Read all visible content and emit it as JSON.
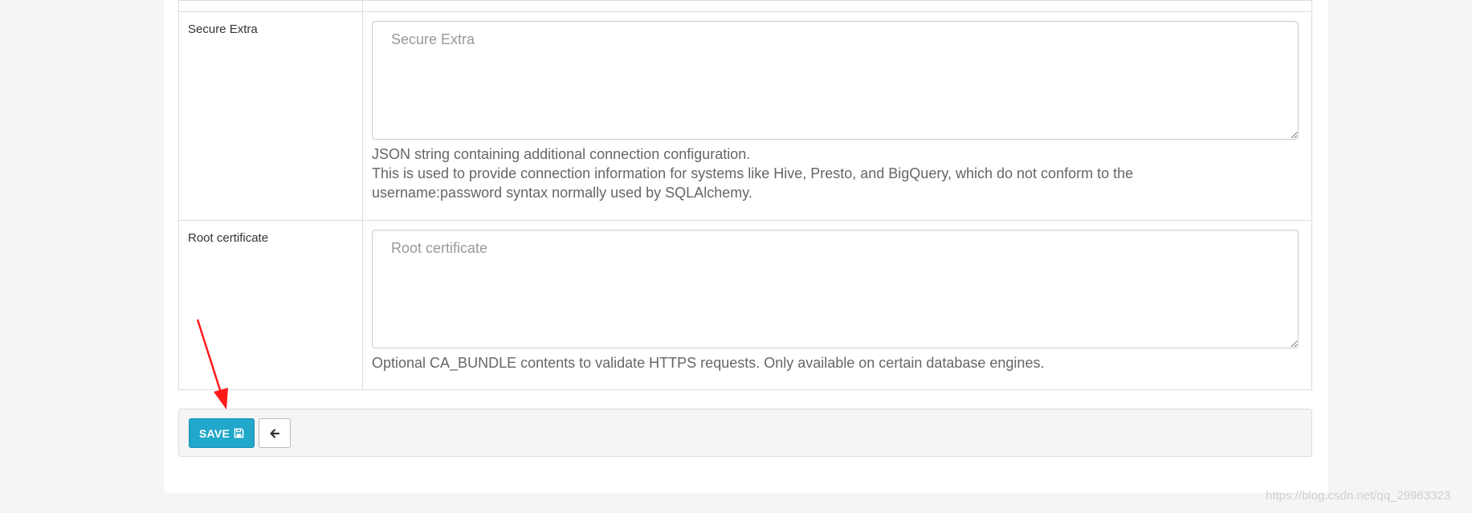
{
  "form": {
    "secure_extra": {
      "label": "Secure Extra",
      "placeholder": "Secure Extra",
      "value": "",
      "help_lines": [
        "JSON string containing additional connection configuration.",
        "This is used to provide connection information for systems like Hive, Presto, and BigQuery, which do not conform to the",
        "username:password syntax normally used by SQLAlchemy."
      ]
    },
    "root_certificate": {
      "label": "Root certificate",
      "placeholder": "Root certificate",
      "value": "",
      "help_lines": [
        "Optional CA_BUNDLE contents to validate HTTPS requests. Only available on certain database engines."
      ]
    }
  },
  "footer": {
    "save_label": "SAVE",
    "save_icon": "floppy-disk-icon",
    "back_icon": "arrow-left-icon"
  },
  "annotation": {
    "arrow_color": "#ff1a1a"
  },
  "watermark": {
    "text": "https://blog.csdn.net/qq_29963323"
  },
  "colors": {
    "primary": "#20a7c9",
    "background": "#f5f5f5",
    "border": "#dcdcdc"
  }
}
